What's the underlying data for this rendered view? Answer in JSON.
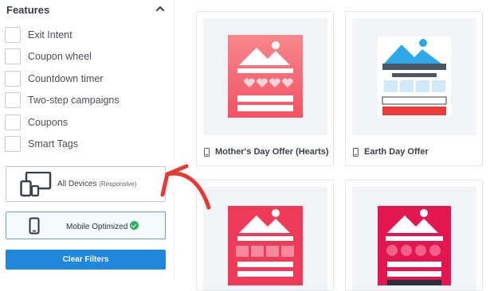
{
  "features": {
    "title": "Features",
    "items": [
      {
        "label": "Exit Intent"
      },
      {
        "label": "Coupon wheel"
      },
      {
        "label": "Countdown timer"
      },
      {
        "label": "Two-step campaigns"
      },
      {
        "label": "Coupons"
      },
      {
        "label": "Smart Tags"
      }
    ]
  },
  "devices": {
    "all_label": "All Devices",
    "all_sub": "(Responsive)",
    "mobile_label": "Mobile Optimized",
    "mobile_selected": true
  },
  "clear_filters_label": "Clear Filters",
  "templates": [
    {
      "name": "Mother's Day Offer (Hearts)",
      "color": "#f5646f"
    },
    {
      "name": "Earth Day Offer",
      "color": "#2ea8e6"
    },
    {
      "name": "",
      "color": "#ef3a5a"
    },
    {
      "name": "",
      "color": "#e3164f"
    }
  ],
  "colors": {
    "accent": "#1f87dc",
    "annotation_arrow": "#e53935",
    "check": "#2eae5e"
  }
}
